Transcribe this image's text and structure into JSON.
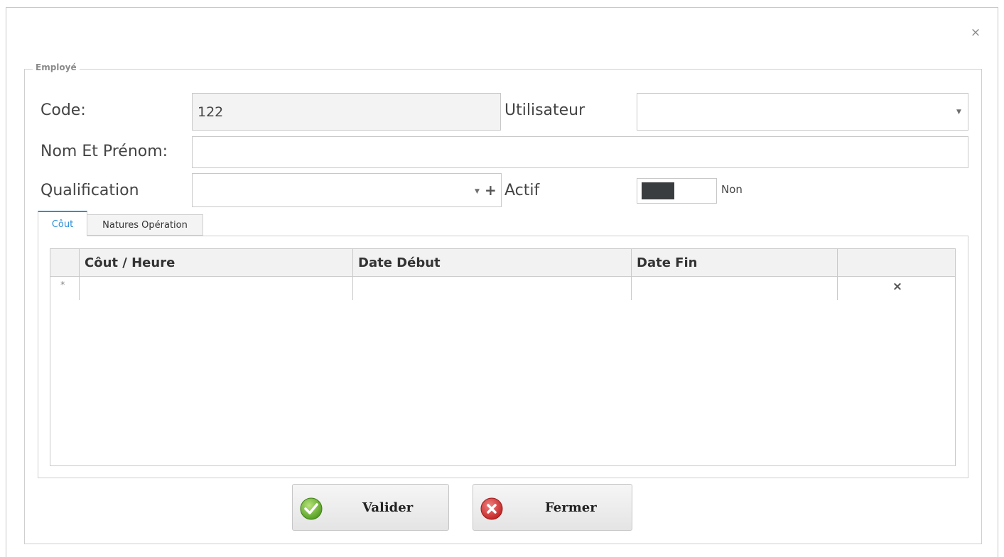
{
  "window": {
    "close_label": "×"
  },
  "group": {
    "title": "Employé"
  },
  "form": {
    "code_label": "Code:",
    "code_value": "122",
    "utilisateur_label": "Utilisateur",
    "utilisateur_value": "",
    "nom_label": "Nom Et Prénom:",
    "nom_value": "",
    "qualification_label": "Qualification",
    "qualification_value": "",
    "add_symbol": "+",
    "actif_label": "Actif",
    "actif_state": "Non",
    "actif_on": false
  },
  "tabs": [
    {
      "label": "Côut",
      "active": true
    },
    {
      "label": "Natures Opération",
      "active": false
    }
  ],
  "grid": {
    "columns": [
      "Côut / Heure",
      "Date Début",
      "Date Fin",
      ""
    ],
    "new_row_marker": "*",
    "delete_symbol": "×",
    "rows": []
  },
  "buttons": {
    "validate_label": "Valider",
    "close_label": "Fermer"
  },
  "colors": {
    "accent": "#2d8fd6",
    "validate_icon": "#5aaa2a",
    "close_icon": "#d23a3a"
  },
  "icons": {
    "validate": "check-circle-icon",
    "close": "cancel-circle-icon"
  }
}
